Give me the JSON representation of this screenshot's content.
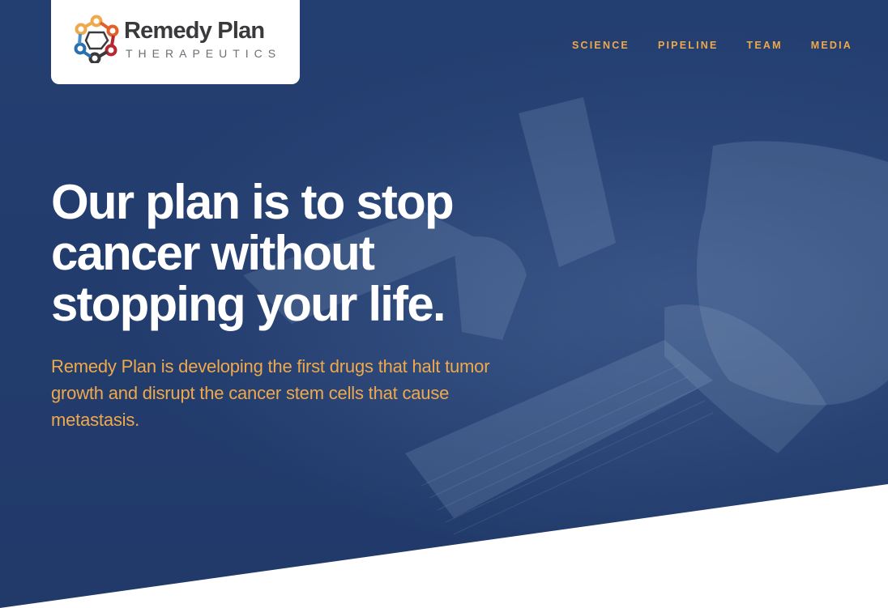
{
  "brand": {
    "name": "Remedy Plan",
    "tagline": "THERAPEUTICS",
    "logo_colors": [
      "#f0a94a",
      "#e0622a",
      "#b8272f",
      "#3a3a3c",
      "#2a6fae",
      "#4a90c8"
    ]
  },
  "nav": {
    "items": [
      {
        "label": "SCIENCE"
      },
      {
        "label": "PIPELINE"
      },
      {
        "label": "TEAM"
      },
      {
        "label": "MEDIA"
      }
    ]
  },
  "hero": {
    "headline": "Our plan is to stop cancer without stopping your life.",
    "subtext": "Remedy Plan is developing the first drugs that halt tumor growth and disrupt the cancer stem cells that cause metastasis.",
    "background_image": "lab-researcher-pipetting-photo",
    "overlay_color": "#213a6a",
    "accent_color": "#f0a94a"
  }
}
